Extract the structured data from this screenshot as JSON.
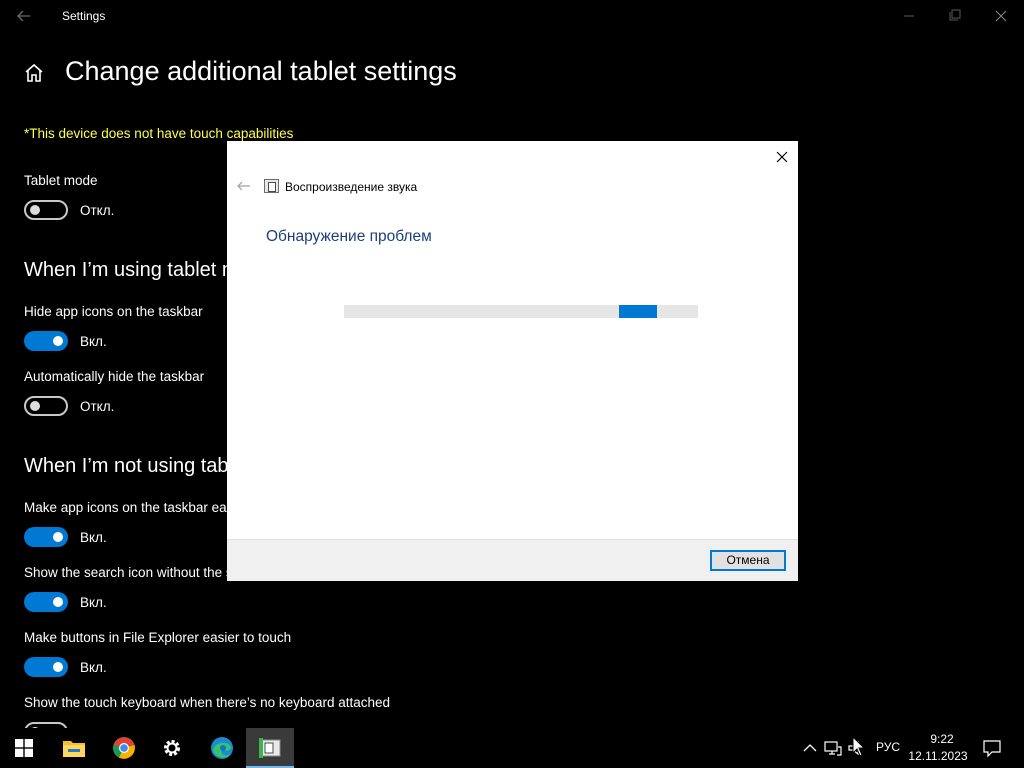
{
  "window": {
    "title": "Settings",
    "controls": [
      "minimize-icon",
      "maximize-icon",
      "close-icon"
    ]
  },
  "page": {
    "title": "Change additional tablet settings",
    "warning": "*This device does not have touch capabilities"
  },
  "tablet_mode": {
    "label": "Tablet mode",
    "state": "Откл.",
    "on": false
  },
  "section_using": {
    "heading": "When I’m using tablet mode",
    "items": [
      {
        "label": "Hide app icons on the taskbar",
        "state": "Вкл.",
        "on": true
      },
      {
        "label": "Automatically hide the taskbar",
        "state": "Откл.",
        "on": false
      }
    ]
  },
  "section_not_using": {
    "heading": "When I’m not using tablet mode",
    "items": [
      {
        "label": "Make app icons on the taskbar easier to touch",
        "state": "Вкл.",
        "on": true
      },
      {
        "label": "Show the search icon without the search box",
        "state": "Вкл.",
        "on": true
      },
      {
        "label": "Make buttons in File Explorer easier to touch",
        "state": "Вкл.",
        "on": true
      },
      {
        "label": "Show the touch keyboard when there’s no keyboard attached"
      }
    ]
  },
  "dialog": {
    "app_title": "Воспроизведение звука",
    "heading": "Обнаружение проблем",
    "progress_marquee": {
      "start": 0.776,
      "end": 0.884
    },
    "cancel_label": "Отмена",
    "accent_color": "#0078d4"
  },
  "taskbar": {
    "apps": [
      "start-icon",
      "file-explorer-icon",
      "chrome-icon",
      "settings-icon",
      "edge-icon",
      "troubleshooter-icon"
    ],
    "language": "РУС",
    "time": "9:22",
    "date": "12.11.2023"
  }
}
